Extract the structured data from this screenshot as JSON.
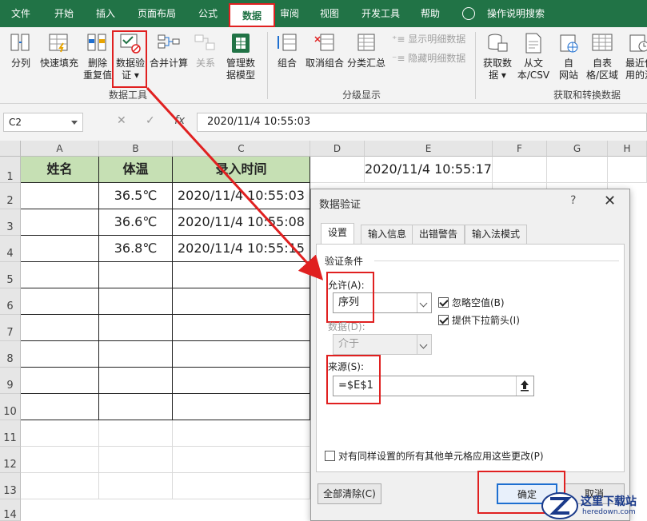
{
  "colors": {
    "ribbon_green": "#217346",
    "highlight_red": "#e02020",
    "header_fill": "#c6e0b4"
  },
  "tabs": [
    {
      "label": "文件"
    },
    {
      "label": "开始"
    },
    {
      "label": "插入"
    },
    {
      "label": "页面布局"
    },
    {
      "label": "公式"
    },
    {
      "label": "数据",
      "active": true
    },
    {
      "label": "审阅"
    },
    {
      "label": "视图"
    },
    {
      "label": "开发工具"
    },
    {
      "label": "帮助"
    },
    {
      "label": "操作说明搜索"
    }
  ],
  "ribbon": {
    "data_tools": {
      "fenlie": "分列",
      "kuaisu": "快速填充",
      "shanchu_1": "删除",
      "shanchu_2": "重复值",
      "yanzheng_1": "数据验",
      "yanzheng_2": "证 ▾",
      "hebing": "合并计算",
      "guanxi": "关系",
      "guanli_1": "管理数",
      "guanli_2": "据模型",
      "label": "数据工具"
    },
    "outline": {
      "zuhe": "组合",
      "quxiao": "取消组合",
      "fenlei": "分类汇总",
      "xianshi": "显示明细数据",
      "yincang": "隐藏明细数据",
      "label": "分级显示"
    },
    "get_transform": {
      "huoqu_1": "获取数",
      "huoqu_2": "据 ▾",
      "wenben_1": "从文",
      "wenben_2": "本/CSV",
      "wangzhan_1": "自",
      "wangzhan_2": "网站",
      "biaoge_1": "自表",
      "biaoge_2": "格/区域",
      "zuijin_1": "最近使",
      "zuijin_2": "用的源",
      "label": "获取和转换数据"
    }
  },
  "formula_bar": {
    "name_box": "C2",
    "fx": "fx",
    "cancel": "✕",
    "confirm": "✓",
    "value": "2020/11/4  10:55:03"
  },
  "sheet": {
    "columns": [
      "A",
      "B",
      "C",
      "D",
      "E",
      "F",
      "G",
      "H"
    ],
    "rows": [
      "1",
      "2",
      "3",
      "4",
      "5",
      "6",
      "7",
      "8",
      "9",
      "10",
      "11",
      "12",
      "13",
      "14"
    ],
    "headers": {
      "a1": "姓名",
      "b1": "体温",
      "c1": "录入时间"
    },
    "e1": "2020/11/4 10:55:17",
    "data": [
      {
        "temp": "36.5℃",
        "time": "2020/11/4 10:55:03"
      },
      {
        "temp": "36.6℃",
        "time": "2020/11/4 10:55:08"
      },
      {
        "temp": "36.8℃",
        "time": "2020/11/4 10:55:15"
      }
    ]
  },
  "dialog": {
    "title": "数据验证",
    "help": "?",
    "close": "✕",
    "tabs": [
      "设置",
      "输入信息",
      "出错警告",
      "输入法模式"
    ],
    "section": "验证条件",
    "allow_label": "允许(A):",
    "allow_value": "序列",
    "data_label": "数据(D):",
    "data_value": "介于",
    "ignore_blank": "忽略空值(B)",
    "dropdown_arrow": "提供下拉箭头(I)",
    "source_label": "来源(S):",
    "source_value": "=$E$1",
    "apply_all": "对有同样设置的所有其他单元格应用这些更改(P)",
    "clear_all": "全部清除(C)",
    "ok": "确定",
    "cancel": "取消"
  },
  "watermark": {
    "text": "这里下载站",
    "url": "heredown.com"
  }
}
